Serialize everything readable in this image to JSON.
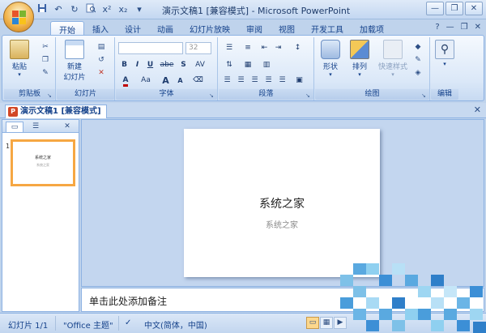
{
  "title_bar": {
    "document_title": "演示文稿1 [兼容模式] - Microsoft PowerPoint",
    "minimize": "—",
    "restore": "❐",
    "close": "✕"
  },
  "quick_access": {
    "save_icon": "save-icon",
    "undo": "↶",
    "redo": "↻",
    "print_preview": "🔍",
    "superscript": "x²",
    "subscript": "x₂",
    "customize": "▾"
  },
  "tabs": [
    "开始",
    "插入",
    "设计",
    "动画",
    "幻灯片放映",
    "审阅",
    "视图",
    "开发工具",
    "加载项"
  ],
  "active_tab_index": 0,
  "tabs_right": {
    "help": "?",
    "minimize_ribbon": "—",
    "restore": "❐",
    "close": "✕"
  },
  "ribbon": {
    "clipboard": {
      "label": "剪贴板",
      "paste": "粘贴"
    },
    "slides": {
      "label": "幻灯片",
      "new_slide_line1": "新建",
      "new_slide_line2": "幻灯片"
    },
    "font": {
      "label": "字体",
      "font_size": "32",
      "bold": "B",
      "italic": "I",
      "underline": "U",
      "strike": "abe",
      "shadow": "S",
      "spacing": "AV",
      "case": "Aa",
      "grow": "A",
      "shrink": "A"
    },
    "paragraph": {
      "label": "段落"
    },
    "drawing": {
      "label": "绘图",
      "shapes": "形状",
      "arrange": "排列",
      "quick_styles": "快速样式"
    },
    "editing": {
      "label": "编辑"
    }
  },
  "document_tab": {
    "title": "演示文稿1 [兼容模式]",
    "close": "✕"
  },
  "slide_pane": {
    "close": "✕",
    "thumbnail_number": "1",
    "thumbnail_title": "系统之家",
    "thumbnail_subtitle": "系统之家"
  },
  "slide": {
    "title": "系统之家",
    "subtitle": "系统之家"
  },
  "notes": {
    "placeholder": "单击此处添加备注"
  },
  "status_bar": {
    "slide_counter": "幻灯片 1/1",
    "theme": "\"Office 主题\"",
    "language": "中文(简体，中国)"
  },
  "colors": {
    "ribbon_bg": "#dbe8f8",
    "accent": "#15428b",
    "thumbnail_selected": "#f6a743",
    "office_button": "#f1b44c"
  }
}
